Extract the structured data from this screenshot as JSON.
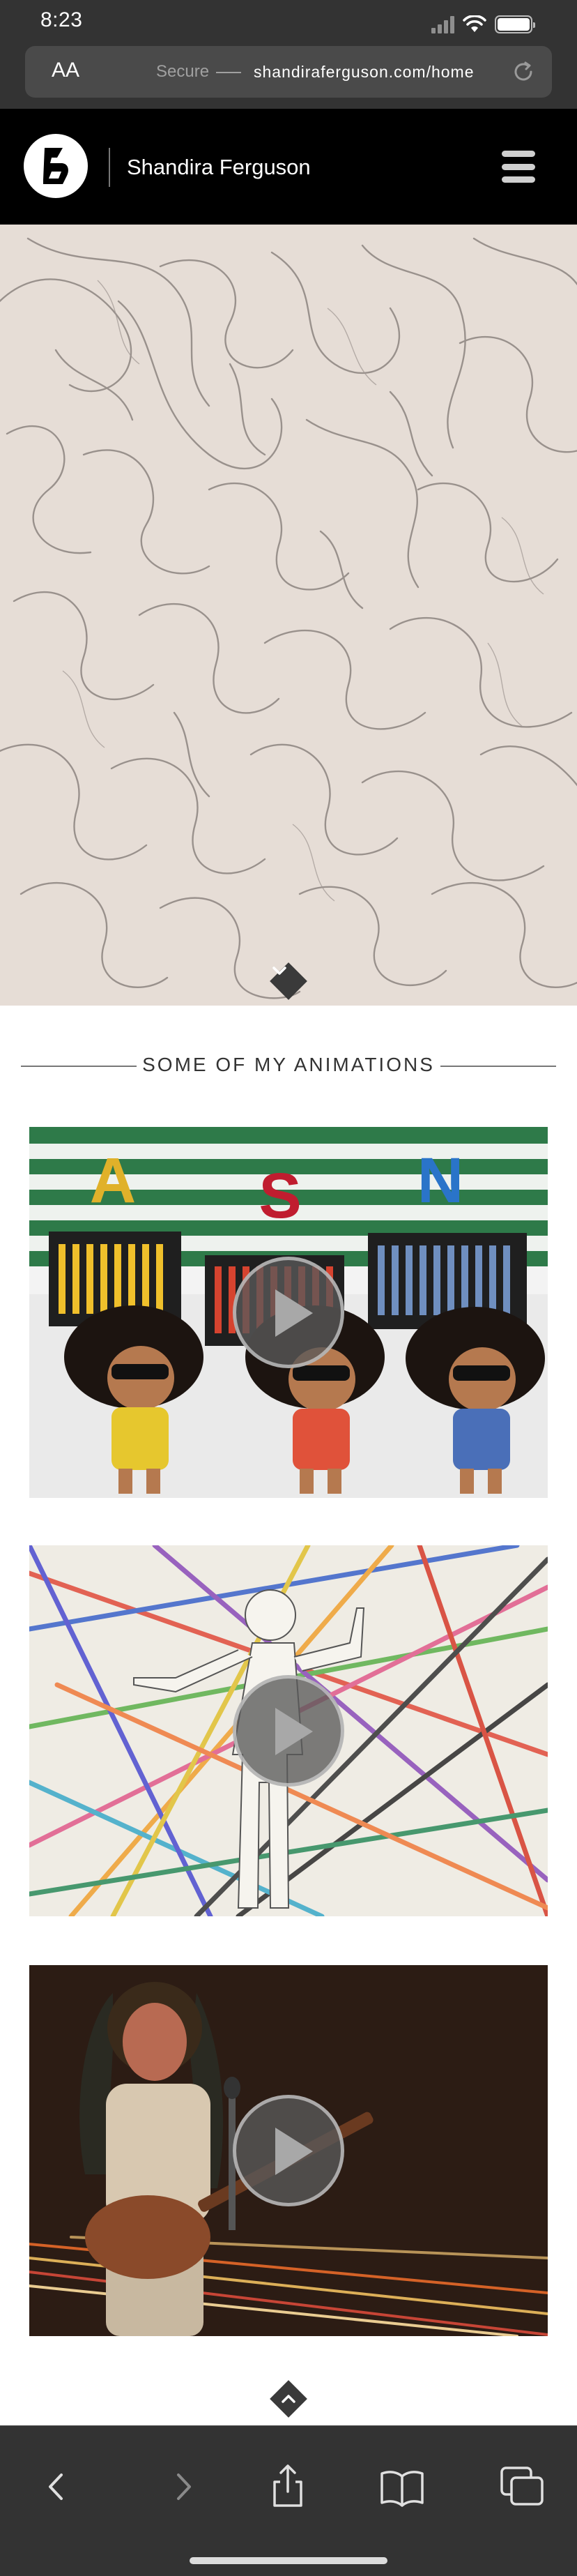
{
  "status_bar": {
    "time": "8:23"
  },
  "url_bar": {
    "text_size_label": "AA",
    "secure_label": "Secure",
    "host": "shandiraferguson.com/home"
  },
  "site": {
    "name": "Shandira Ferguson"
  },
  "section": {
    "title": "SOME OF MY ANIMATIONS"
  },
  "videos": [
    {
      "thumb_letters": [
        "A",
        "S",
        "N"
      ]
    },
    {},
    {}
  ],
  "icons": {
    "reload": "reload-icon",
    "menu": "hamburger-menu-icon",
    "back": "back-arrow-icon",
    "forward": "forward-arrow-icon",
    "share": "share-icon",
    "bookmarks": "book-icon",
    "tabs": "tabs-icon"
  },
  "colors": {
    "header_bg": "#000000",
    "chrome_bg": "#333333",
    "hero_bg": "#e6ddd6"
  }
}
